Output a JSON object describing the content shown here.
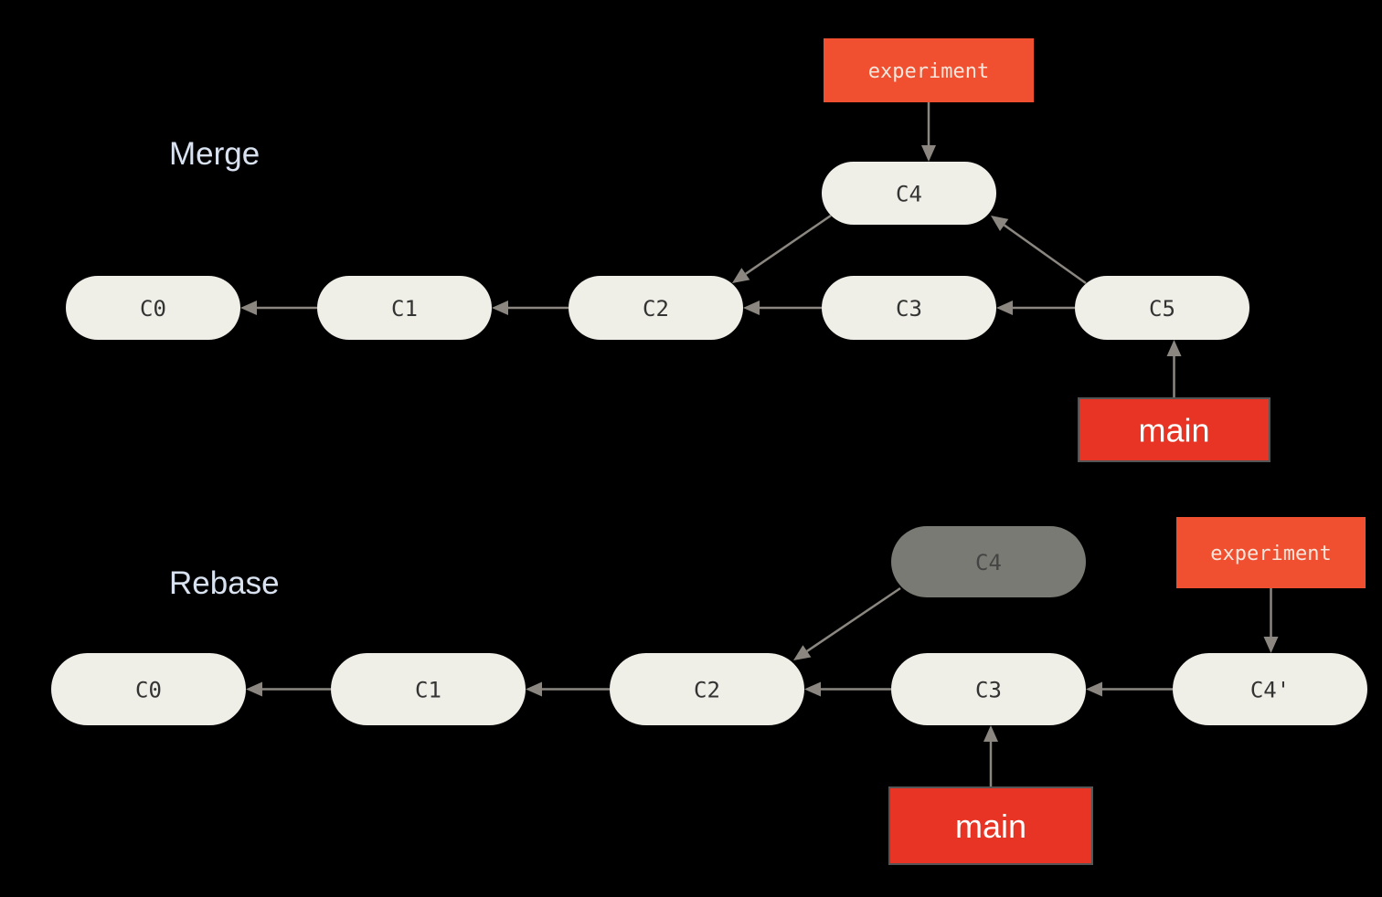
{
  "diagram": {
    "colors": {
      "background": "#000000",
      "commit_fill": "#efeee7",
      "commit_ghost_fill": "#7a7a74",
      "edge": "#8b8780",
      "experiment_branch": "#f05030",
      "main_branch": "#e83424",
      "title_text": "#d9e2f0"
    },
    "sections": [
      {
        "id": "merge",
        "title": "Merge",
        "commits": [
          {
            "id": "C0",
            "label": "C0",
            "ghost": false
          },
          {
            "id": "C1",
            "label": "C1",
            "ghost": false
          },
          {
            "id": "C2",
            "label": "C2",
            "ghost": false
          },
          {
            "id": "C3",
            "label": "C3",
            "ghost": false
          },
          {
            "id": "C4",
            "label": "C4",
            "ghost": false
          },
          {
            "id": "C5",
            "label": "C5",
            "ghost": false
          }
        ],
        "edges": [
          {
            "from": "C1",
            "to": "C0"
          },
          {
            "from": "C2",
            "to": "C1"
          },
          {
            "from": "C3",
            "to": "C2"
          },
          {
            "from": "C4",
            "to": "C2"
          },
          {
            "from": "C5",
            "to": "C3"
          },
          {
            "from": "C5",
            "to": "C4"
          }
        ],
        "branches": [
          {
            "name": "experiment",
            "points_to": "C4",
            "style": "experiment"
          },
          {
            "name": "main",
            "points_to": "C5",
            "style": "main"
          }
        ]
      },
      {
        "id": "rebase",
        "title": "Rebase",
        "commits": [
          {
            "id": "C0",
            "label": "C0",
            "ghost": false
          },
          {
            "id": "C1",
            "label": "C1",
            "ghost": false
          },
          {
            "id": "C2",
            "label": "C2",
            "ghost": false
          },
          {
            "id": "C3",
            "label": "C3",
            "ghost": false
          },
          {
            "id": "C4",
            "label": "C4",
            "ghost": true
          },
          {
            "id": "C4p",
            "label": "C4'",
            "ghost": false
          }
        ],
        "edges": [
          {
            "from": "C1",
            "to": "C0"
          },
          {
            "from": "C2",
            "to": "C1"
          },
          {
            "from": "C3",
            "to": "C2"
          },
          {
            "from": "C4",
            "to": "C2"
          },
          {
            "from": "C4p",
            "to": "C3"
          }
        ],
        "branches": [
          {
            "name": "experiment",
            "points_to": "C4p",
            "style": "experiment"
          },
          {
            "name": "main",
            "points_to": "C3",
            "style": "main"
          }
        ]
      }
    ]
  }
}
